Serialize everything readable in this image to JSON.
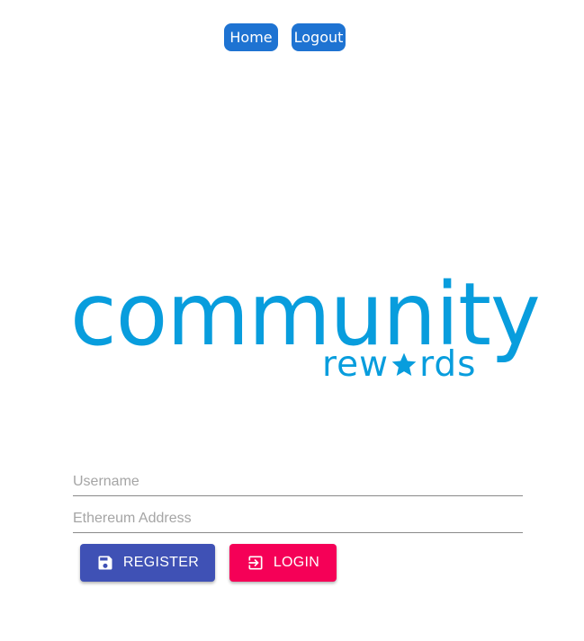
{
  "nav": {
    "home_label": "Home",
    "logout_label": "Logout"
  },
  "logo": {
    "word_main": "community",
    "word_sub_left": "rew",
    "word_sub_right": "rds",
    "icon": "star-icon"
  },
  "form": {
    "username_placeholder": "Username",
    "eth_placeholder": "Ethereum Address",
    "username_value": "",
    "eth_value": ""
  },
  "actions": {
    "register_label": "REGISTER",
    "register_icon": "save-icon",
    "login_label": "LOGIN",
    "login_icon": "login-icon"
  },
  "colors": {
    "nav_bg": "#1e73d2",
    "logo": "#089ddd",
    "register_bg": "#3f51b5",
    "login_bg": "#f50057"
  }
}
